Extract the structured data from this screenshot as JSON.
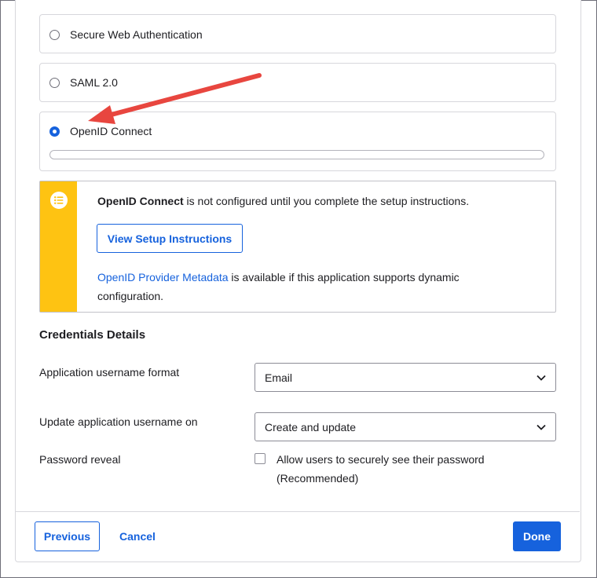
{
  "auth_options": [
    {
      "label": "Secure Web Authentication",
      "selected": false
    },
    {
      "label": "SAML 2.0",
      "selected": false
    },
    {
      "label": "OpenID Connect",
      "selected": true
    }
  ],
  "progress": {
    "value": 0
  },
  "callout": {
    "icon": "list-icon",
    "strong": "OpenID Connect",
    "text": " is not configured until you complete the setup instructions.",
    "button_label": "View Setup Instructions",
    "link_text": "OpenID Provider Metadata",
    "desc_text": " is available if this application supports dynamic configuration."
  },
  "credentials": {
    "title": "Credentials Details",
    "username_format_label": "Application username format",
    "username_format_value": "Email",
    "update_on_label": "Update application username on",
    "update_on_value": "Create and update",
    "password_reveal_label": "Password reveal",
    "password_reveal_checkbox": "Allow users to securely see their password (Recommended)",
    "password_reveal_checked": false
  },
  "footer": {
    "previous": "Previous",
    "cancel": "Cancel",
    "done": "Done"
  },
  "colors": {
    "accent": "#1662dd",
    "warning": "#fec312",
    "annotation_arrow": "#e8463f"
  }
}
